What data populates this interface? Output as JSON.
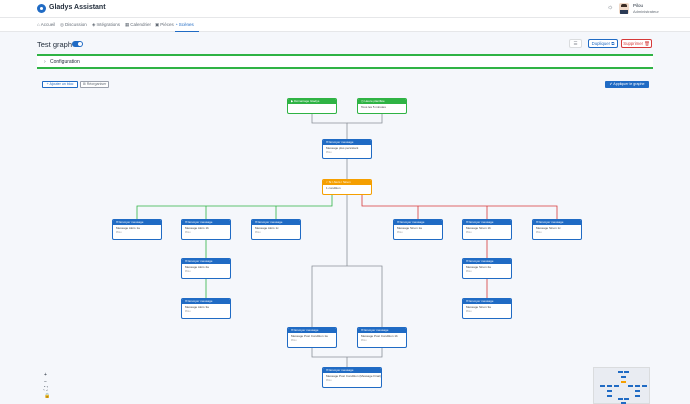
{
  "app": {
    "title": "Gladys Assistant"
  },
  "user": {
    "name": "Pilou",
    "role": "Administrateur"
  },
  "nav": [
    {
      "icon": "⌂",
      "label": "Accueil"
    },
    {
      "icon": "◎",
      "label": "Discussion"
    },
    {
      "icon": "◈",
      "label": "Intégrations"
    },
    {
      "icon": "▦",
      "label": "Calendrier"
    },
    {
      "icon": "▣",
      "label": "Pièces"
    },
    {
      "icon": "◔",
      "label": "Scènes"
    }
  ],
  "page": {
    "title": "Test graph",
    "buttons": {
      "duplicate": "Dupliquer ⧉",
      "delete": "Supprimer 🗑"
    },
    "config": "Configuration",
    "add_block": "+ Ajouter un bloc",
    "reorganize": "⊞ Réorganiser",
    "apply": "✔ Appliquer le graphe"
  },
  "nodes": {
    "start": {
      "title": "▶ Démarrage Gladys",
      "body": ""
    },
    "time": {
      "title": "◷ Heure planifiée",
      "body": "Tous les 5 minutes"
    },
    "send0": {
      "title": "✉ Envoyer message",
      "body": "Message plus persistant",
      "sub": "Pilou"
    },
    "cond": {
      "title": "⑂ Si / Alors / Sinon",
      "body": "1 condition"
    },
    "yes_a": {
      "title": "✉ Envoyer message",
      "body": "Message Alors 1a",
      "sub": "Pilou"
    },
    "yes_b": {
      "title": "✉ Envoyer message",
      "body": "Message Alors 1b",
      "sub": "Pilou"
    },
    "yes_c": {
      "title": "✉ Envoyer message",
      "body": "Message Alors 1c",
      "sub": "Pilou"
    },
    "no_a": {
      "title": "✉ Envoyer message",
      "body": "Message Sinon 1a",
      "sub": "Pilou"
    },
    "no_b": {
      "title": "✉ Envoyer message",
      "body": "Message Sinon 1b",
      "sub": "Pilou"
    },
    "no_c": {
      "title": "✉ Envoyer message",
      "body": "Message Sinon 1c",
      "sub": "Pilou"
    },
    "yes_2": {
      "title": "✉ Envoyer message",
      "body": "Message Alors 2a",
      "sub": "Pilou"
    },
    "yes_3": {
      "title": "✉ Envoyer message",
      "body": "Message Alors 3a",
      "sub": "Pilou"
    },
    "no_2": {
      "title": "✉ Envoyer message",
      "body": "Message Sinon 2a",
      "sub": "Pilou"
    },
    "no_3": {
      "title": "✉ Envoyer message",
      "body": "Message Sinon 3a",
      "sub": "Pilou"
    },
    "post_a": {
      "title": "✉ Envoyer message",
      "body": "Message Post Condition 1a",
      "sub": "Pilou"
    },
    "post_b": {
      "title": "✉ Envoyer message",
      "body": "Message Post Condition 1b",
      "sub": "Pilou"
    },
    "final": {
      "title": "✉ Envoyer message",
      "body": "Message Post Condition (Message Final)",
      "sub": "Pilou"
    }
  },
  "canvas_tools": [
    "+",
    "−",
    "⛶",
    "🔒"
  ],
  "colors": {
    "primary": "#206bc4",
    "green": "#2fb344",
    "orange": "#f59f00",
    "red": "#d63939"
  }
}
